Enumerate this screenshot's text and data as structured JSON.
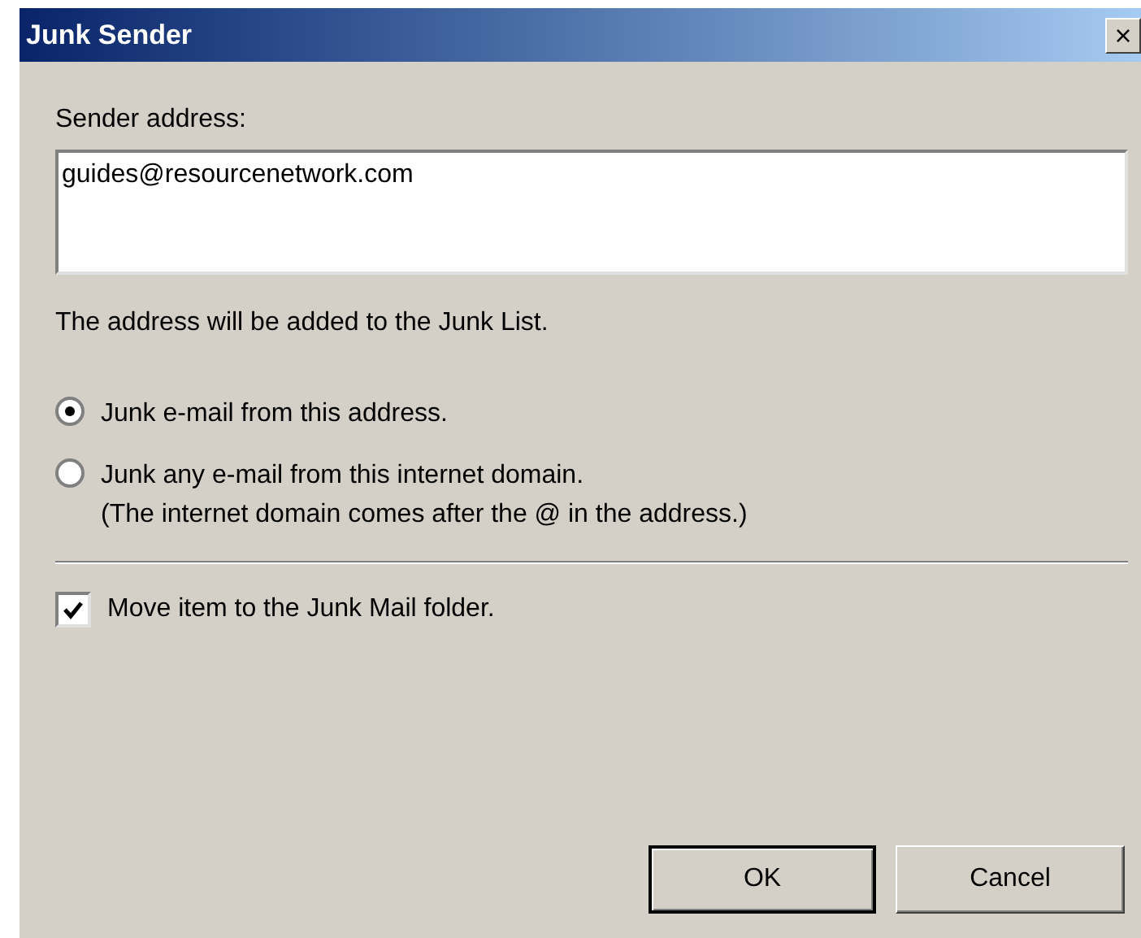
{
  "window": {
    "title": "Junk Sender",
    "close": "×"
  },
  "sender_address": {
    "label": "Sender address:",
    "value": "guides@resourcenetwork.com"
  },
  "note": "The address will be added to the Junk List.",
  "options": [
    {
      "label": "Junk e-mail from this address.",
      "selected": true
    },
    {
      "label": "Junk any e-mail from this internet domain.",
      "hint": "(The internet domain comes after the @ in the address.)",
      "selected": false
    }
  ],
  "move_to_junk": {
    "label": "Move item to the Junk Mail folder.",
    "checked": true
  },
  "buttons": [
    {
      "label": "OK",
      "default": true
    },
    {
      "label": "Cancel",
      "default": false
    }
  ]
}
